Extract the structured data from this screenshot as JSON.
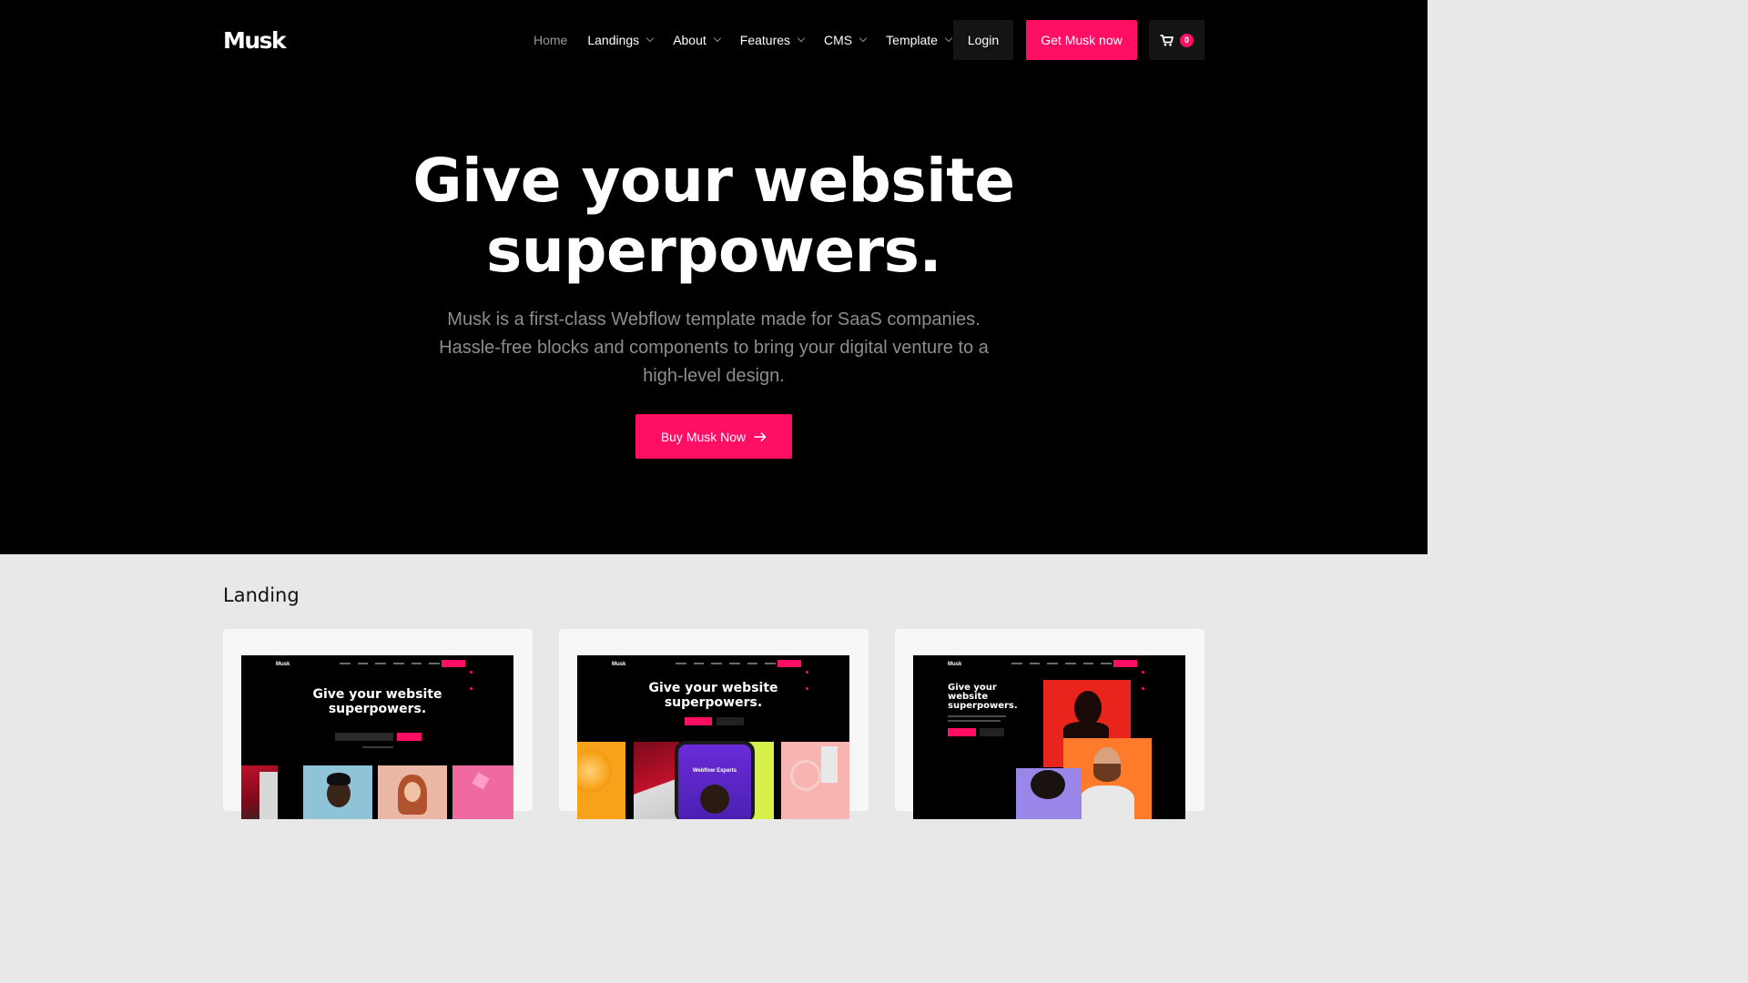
{
  "header": {
    "logo": "Musk",
    "nav": [
      {
        "label": "Home",
        "dropdown": false
      },
      {
        "label": "Landings",
        "dropdown": true
      },
      {
        "label": "About",
        "dropdown": true
      },
      {
        "label": "Features",
        "dropdown": true
      },
      {
        "label": "CMS",
        "dropdown": true
      },
      {
        "label": "Template",
        "dropdown": true
      }
    ],
    "login_label": "Login",
    "cta_label": "Get Musk now",
    "cart_count": "0"
  },
  "hero": {
    "headline_line1": "Give your website",
    "headline_line2": "superpowers.",
    "subhead_line1": "Musk is a first-class Webflow template made for SaaS companies.",
    "subhead_line2": "Hassle-free blocks and components to bring your digital venture to a",
    "subhead_line3": "high-level design.",
    "button_label": "Buy Musk Now"
  },
  "landing": {
    "section_title": "Landing",
    "cards": [
      {
        "preview_logo": "Musk",
        "preview_title_line1": "Give your website",
        "preview_title_line2": "superpowers."
      },
      {
        "preview_logo": "Musk",
        "preview_title_line1": "Give your website",
        "preview_title_line2": "superpowers.",
        "preview_phone_label": "Webflow Experts"
      },
      {
        "preview_logo": "Musk",
        "preview_title_line1": "Give your",
        "preview_title_line2": "website",
        "preview_title_line3": "superpowers."
      }
    ]
  },
  "colors": {
    "accent": "#ff0f64",
    "hero_bg": "#000000",
    "page_bg": "#e8e8e8",
    "card_bg": "#f7f7f7"
  }
}
